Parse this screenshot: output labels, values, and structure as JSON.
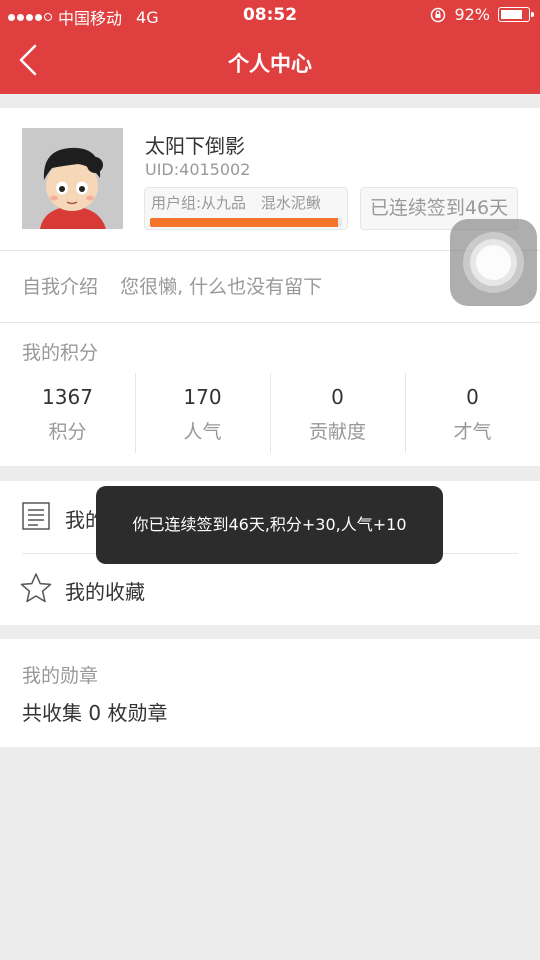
{
  "status_bar": {
    "carrier": "中国移动",
    "network": "4G",
    "time": "08:52",
    "battery": "92%",
    "battery_level": 0.92
  },
  "nav": {
    "title": "个人中心"
  },
  "profile": {
    "username": "太阳下倒影",
    "uid": "UID:4015002",
    "group": "用户组:从九品",
    "rank": "混水泥鳅",
    "group_progress": 0.98,
    "checkin_label": "已连续签到46天",
    "intro_label": "自我介绍",
    "intro_text": "您很懒, 什么也没有留下"
  },
  "points": {
    "section_title": "我的积分",
    "stats": [
      {
        "value": "1367",
        "label": "积分"
      },
      {
        "value": "170",
        "label": "人气"
      },
      {
        "value": "0",
        "label": "贡献度"
      },
      {
        "value": "0",
        "label": "才气"
      }
    ]
  },
  "menu": {
    "posts_label": "我的帖子",
    "favorites_label": "我的收藏"
  },
  "medals": {
    "section_title": "我的勋章",
    "count_text": "共收集 0 枚勋章"
  },
  "toast": {
    "text": "你已连续签到46天,积分+30,人气+10"
  },
  "colors": {
    "brand": "#e03f3f",
    "progress": "#f4742b"
  },
  "icons": [
    "back-arrow-icon",
    "rotation-lock-icon",
    "battery-icon",
    "document-icon",
    "star-icon",
    "assistive-touch-icon"
  ]
}
